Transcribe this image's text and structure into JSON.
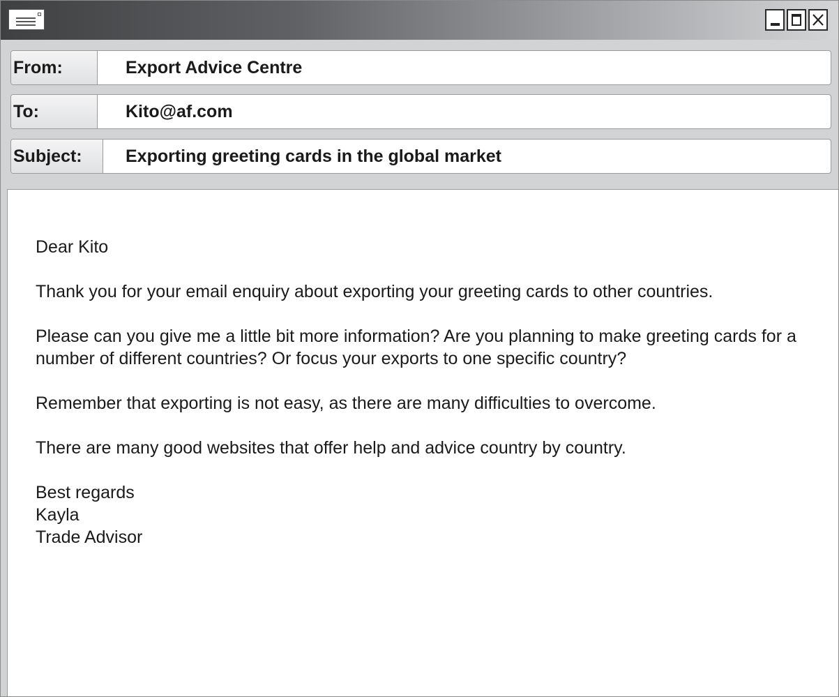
{
  "window": {
    "icons": {
      "app": "mail-window-icon",
      "minimize": "minimize-icon",
      "maximize": "maximize-icon",
      "close": "close-icon"
    }
  },
  "header": {
    "from": {
      "label": "From:",
      "value": "Export Advice Centre"
    },
    "to": {
      "label": "To:",
      "value": "Kito@af.com"
    },
    "subject": {
      "label": "Subject:",
      "value": "Exporting greeting cards in the global market"
    }
  },
  "message": {
    "greeting": "Dear Kito",
    "paragraphs": [
      "Thank you for your email enquiry about exporting your greeting cards to other countries.",
      "Please can you give me a little bit more information? Are you planning to make greeting cards for a number of different countries? Or focus your exports to one specific country?",
      "Remember that exporting is not easy, as there are many difficulties to overcome.",
      "There are many good websites that offer help and advice country by country."
    ],
    "signoff": "Best regards",
    "sender_name": "Kayla",
    "sender_title": "Trade Advisor"
  }
}
